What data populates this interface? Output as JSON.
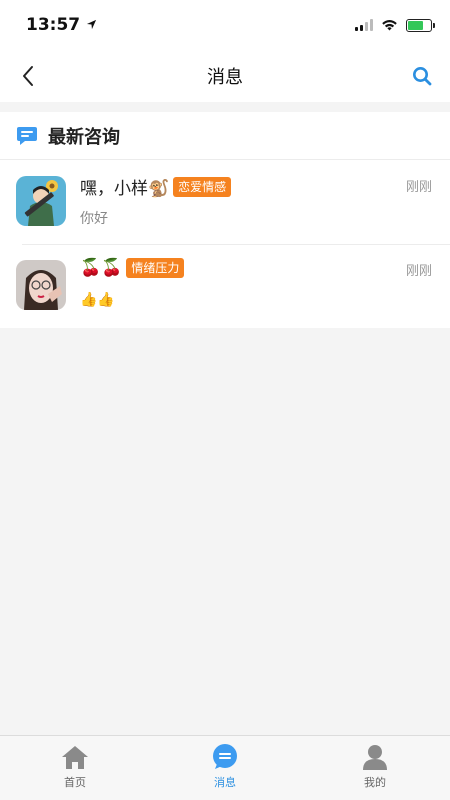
{
  "status_bar": {
    "time": "13:57"
  },
  "nav": {
    "title": "消息"
  },
  "section": {
    "title": "最新咨询"
  },
  "messages": [
    {
      "name": "嘿，小样🐒",
      "tag": "恋爱情感",
      "time": "刚刚",
      "preview": "你好"
    },
    {
      "name": "🍒🍒",
      "tag": "情绪压力",
      "time": "刚刚",
      "preview": "👍👍"
    }
  ],
  "tabs": [
    {
      "label": "首页",
      "icon": "home-icon"
    },
    {
      "label": "消息",
      "icon": "message-icon"
    },
    {
      "label": "我的",
      "icon": "user-icon"
    }
  ],
  "colors": {
    "accent": "#2b8fe0",
    "tag": "#f5821f",
    "inactive_icon": "#8a8a8a"
  }
}
